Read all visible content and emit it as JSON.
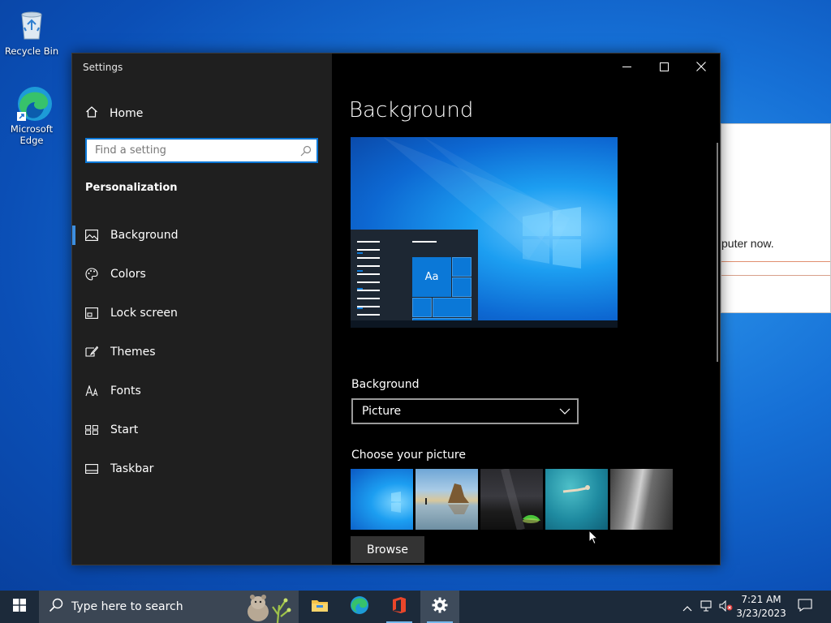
{
  "desktop": {
    "icons": [
      {
        "label": "Recycle Bin"
      },
      {
        "label": "Microsoft Edge"
      }
    ],
    "background_dialog": {
      "visible_text": "puter now."
    }
  },
  "window": {
    "title": "Settings",
    "controls": {
      "minimize": "minimize",
      "maximize": "maximize",
      "close": "close"
    }
  },
  "sidebar": {
    "home_label": "Home",
    "search_placeholder": "Find a setting",
    "section_title": "Personalization",
    "items": [
      {
        "label": "Background",
        "icon": "picture-icon",
        "active": true
      },
      {
        "label": "Colors",
        "icon": "palette-icon"
      },
      {
        "label": "Lock screen",
        "icon": "lock-screen-icon"
      },
      {
        "label": "Themes",
        "icon": "brush-icon"
      },
      {
        "label": "Fonts",
        "icon": "font-icon"
      },
      {
        "label": "Start",
        "icon": "start-icon"
      },
      {
        "label": "Taskbar",
        "icon": "taskbar-icon"
      }
    ]
  },
  "main": {
    "title": "Background",
    "preview": {
      "sample_text": "Aa"
    },
    "background_label": "Background",
    "background_value": "Picture",
    "choose_picture_label": "Choose your picture",
    "pictures": [
      "windows-light",
      "beach-rocks",
      "night-sky",
      "underwater-swimmer",
      "rock-cliff"
    ],
    "browse_label": "Browse"
  },
  "taskbar": {
    "search_placeholder": "Type here to search",
    "apps": [
      "file-explorer",
      "microsoft-edge",
      "office",
      "settings"
    ],
    "time": "7:21 AM",
    "date": "3/23/2023"
  },
  "colors": {
    "accent": "#0b78d7",
    "sidebar_bg": "#1f1f1f",
    "main_bg": "#000000",
    "taskbar_bg": "#1c2a3a"
  }
}
